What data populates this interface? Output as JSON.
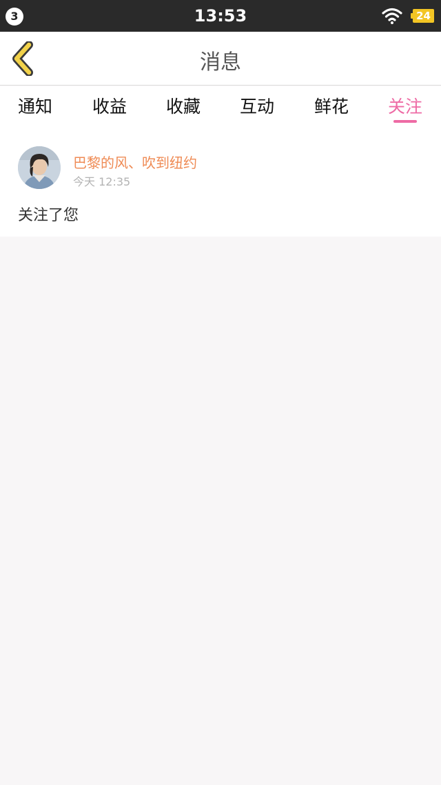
{
  "status_bar": {
    "notification_count": "3",
    "time": "13:53",
    "battery_level": "24",
    "icons": [
      "wifi-icon",
      "battery-icon"
    ]
  },
  "header": {
    "title": "消息",
    "back_icon": "chevron-left-icon"
  },
  "tabs": [
    {
      "label": "通知",
      "active": false
    },
    {
      "label": "收益",
      "active": false
    },
    {
      "label": "收藏",
      "active": false
    },
    {
      "label": "互动",
      "active": false
    },
    {
      "label": "鲜花",
      "active": false
    },
    {
      "label": "关注",
      "active": true
    }
  ],
  "messages": [
    {
      "sender": "巴黎的风、吹到纽约",
      "time": "今天 12:35",
      "body": "关注了您"
    }
  ],
  "colors": {
    "accent": "#ee6ba5",
    "sender_name": "#ef8b55",
    "back_icon": "#f2d24a",
    "battery": "#f3c524",
    "status_bar": "#2a2a2a",
    "page_background": "#f8f6f7"
  }
}
